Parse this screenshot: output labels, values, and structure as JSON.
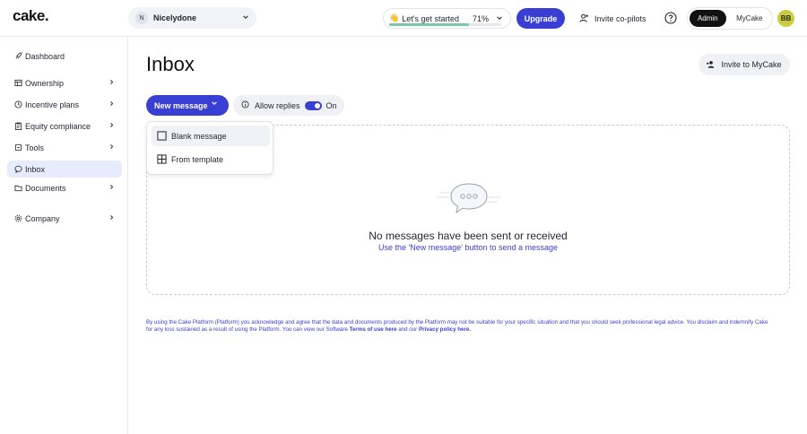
{
  "header": {
    "logo": "cake.",
    "company": {
      "badge": "N",
      "name": "Nicelydone"
    },
    "get_started": {
      "emoji": "👋",
      "label": "Let's get started",
      "percent_label": "71%",
      "progress": 0.71
    },
    "upgrade_label": "Upgrade",
    "copilots_label": "Invite co-pilots",
    "roles": {
      "admin": "Admin",
      "mycake": "MyCake",
      "selected": "Admin"
    },
    "avatar_initials": "BB"
  },
  "sidebar": {
    "items": [
      {
        "label": "Dashboard",
        "icon": "rocket-icon",
        "has_chevron": false
      },
      {
        "label": "Ownership",
        "icon": "table-icon",
        "has_chevron": true
      },
      {
        "label": "Incentive plans",
        "icon": "clock-icon",
        "has_chevron": true
      },
      {
        "label": "Equity compliance",
        "icon": "clipboard-icon",
        "has_chevron": true
      },
      {
        "label": "Tools",
        "icon": "tool-icon",
        "has_chevron": true
      },
      {
        "label": "Inbox",
        "icon": "chat-icon",
        "has_chevron": false,
        "active": true
      },
      {
        "label": "Documents",
        "icon": "folder-icon",
        "has_chevron": true
      },
      {
        "label": "Company",
        "icon": "gear-icon",
        "has_chevron": true
      }
    ]
  },
  "main": {
    "title": "Inbox",
    "invite_button": "Invite to MyCake",
    "new_message_button": "New message",
    "allow_replies": {
      "label": "Allow replies",
      "state": "On",
      "enabled": true
    },
    "dropdown": {
      "items": [
        {
          "label": "Blank message",
          "icon": "checkbox-icon"
        },
        {
          "label": "From template",
          "icon": "grid-icon"
        }
      ]
    },
    "empty_state": {
      "title": "No messages have been sent or received",
      "subtitle": "Use the 'New message' button to send a message"
    },
    "footer": {
      "text_1": "By using the Cake Platform (Platform) you acknowledge and agree that the data and documents produced by the Platform may not be suitable for your specific situation and that you should seek professional legal advice. You disclaim and indemnify Cake for any loss sustained as a result of using the Platform. You can view our Software ",
      "terms_link": "Terms of use here",
      "text_2": " and our ",
      "privacy_link": "Privacy policy here."
    }
  },
  "colors": {
    "accent": "#3a3fd4",
    "active_nav_bg": "#e7ebfc",
    "avatar_bg": "#c9cc3d",
    "progress_fill": "#7bc6a4"
  }
}
